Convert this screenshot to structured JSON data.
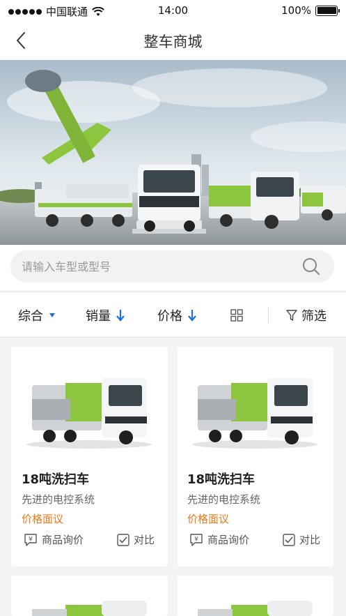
{
  "status_bar": {
    "carrier": "中国联通",
    "time": "14:00",
    "battery_percent": "100%",
    "battery_level": 1.0
  },
  "nav": {
    "title": "整车商城",
    "back_icon": "chevron-left-icon"
  },
  "search": {
    "placeholder": "请输入车型或型号",
    "value": "",
    "icon": "search-icon"
  },
  "filters": {
    "comprehensive": "综合",
    "sales": "销量",
    "price": "价格",
    "filter": "筛选",
    "accent_color": "#1a6ee0",
    "grid_icon": "grid-view-icon",
    "filter_icon": "funnel-icon"
  },
  "products": [
    {
      "title": "18吨洗扫车",
      "desc": "先进的电控系统",
      "price": "价格面议",
      "inquiry": "商品询价",
      "compare": "对比"
    },
    {
      "title": "18吨洗扫车",
      "desc": "先进的电控系统",
      "price": "价格面议",
      "inquiry": "商品询价",
      "compare": "对比"
    },
    {
      "title": "",
      "desc": "",
      "price": "",
      "inquiry": "",
      "compare": ""
    },
    {
      "title": "",
      "desc": "",
      "price": "",
      "inquiry": "",
      "compare": ""
    }
  ],
  "colors": {
    "price": "#f07a19",
    "truck_green": "#8cc63f"
  }
}
